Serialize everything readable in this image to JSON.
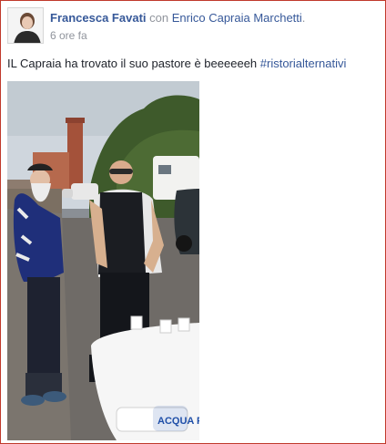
{
  "post": {
    "author": "Francesca Favati",
    "with_prefix": "con",
    "tagged_person": "Enrico Capraia Marchetti",
    "tag_suffix": ".",
    "timestamp": "6 ore fa",
    "text": "IL Capraia ha trovato il suo pastore è beeeeeeh ",
    "hashtag": "#ristorialternativi"
  },
  "photo": {
    "scene_text": "ACQUA FIV"
  },
  "colors": {
    "link_blue": "#365899",
    "meta_gray": "#90949c",
    "frame_border": "#c0392b"
  },
  "icons": {
    "avatar": "profile-photo"
  }
}
